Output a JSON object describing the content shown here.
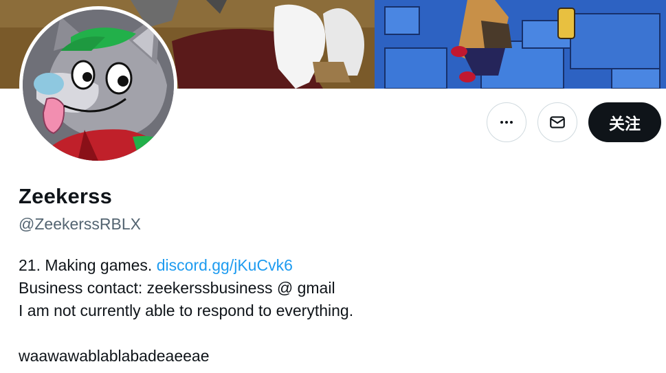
{
  "profile": {
    "display_name": "Zeekerss",
    "handle": "@ZeekerssRBLX",
    "bio": {
      "line1_text": "21. Making games. ",
      "line1_link": "discord.gg/jKuCvk6",
      "line2": "Business contact: zeekerssbusiness @ gmail",
      "line3": "I am not currently able to respond to everything.",
      "line5": "waawawablablabadeaeeae"
    }
  },
  "actions": {
    "more_icon": "more-horizontal-icon",
    "message_icon": "envelope-icon",
    "follow_label": "关注"
  },
  "colors": {
    "link": "#1d9bf0",
    "follow_bg": "#0f1419",
    "handle": "#536471"
  }
}
